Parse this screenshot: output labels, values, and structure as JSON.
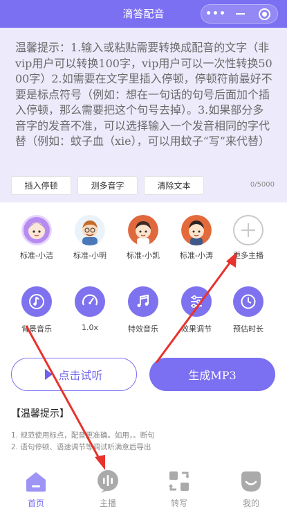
{
  "window": {
    "title": "滴答配音",
    "more_icon": "more-dots-icon",
    "minimize_icon": "minimize-icon",
    "close_icon": "target-circle-icon"
  },
  "notice": {
    "text": "温馨提示：1.输入或粘贴需要转换成配音的文字（非vip用户可以转换100字，vip用户可以一次性转换5000字）2.如需要在文字里插入停顿，停顿符前最好不要是标点符号（例如：想在一句话的句号后面加个插入停顿，那么需要把这个句号去掉）。3.如果部分多音字的发音不准，可以选择输入一个发音相同的字代替（例如：蚊子血（xie），可以用蚊子“写”来代替）"
  },
  "tools": {
    "insert_pause": "插入停顿",
    "polyphone": "测多音字",
    "clear_text": "清除文本",
    "char_count": "0/5000"
  },
  "anchors": [
    {
      "label": "标准-小洁",
      "icon": "female-avatar"
    },
    {
      "label": "标准-小明",
      "icon": "male-avatar-glasses"
    },
    {
      "label": "标准-小凯",
      "icon": "male-avatar"
    },
    {
      "label": "标准-小涛",
      "icon": "male-avatar"
    },
    {
      "label": "更多主播",
      "icon": "plus-circle-icon"
    }
  ],
  "functions": [
    {
      "label": "背景音乐",
      "icon": "music-note-icon"
    },
    {
      "label": "1.0x",
      "icon": "speedometer-icon"
    },
    {
      "label": "特效音乐",
      "icon": "double-note-icon"
    },
    {
      "label": "效果调节",
      "icon": "equalizer-icon"
    },
    {
      "label": "预估时长",
      "icon": "clock-icon"
    }
  ],
  "actions": {
    "listen": "点击试听",
    "generate": "生成MP3"
  },
  "tips": {
    "title": "【温馨提示】",
    "line1": "1. 规范使用标点，配音更准确。如用，。断句",
    "line2": "2. 语句停顿、语速调节等调试听满意后导出"
  },
  "tabs": [
    {
      "label": "首页",
      "active": true
    },
    {
      "label": "主播",
      "active": false
    },
    {
      "label": "转写",
      "active": false
    },
    {
      "label": "我的",
      "active": false
    }
  ],
  "colors": {
    "accent": "#7b6ff2",
    "background_top": "#edeafb",
    "annotation_arrow": "#e8322b"
  }
}
